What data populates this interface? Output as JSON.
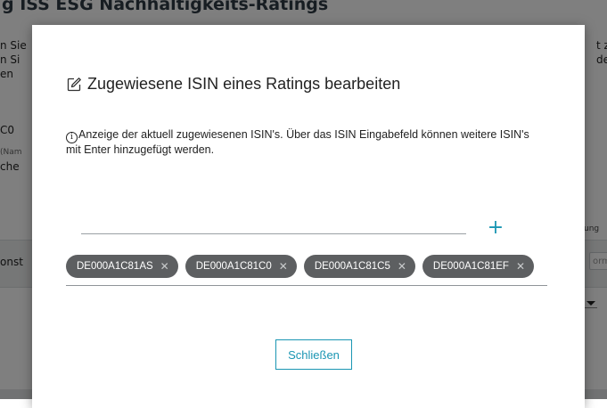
{
  "background": {
    "title": "g ISS ESG Nachhaltigkeits-Ratings",
    "left_fragments": [
      "n Sie",
      "n Si",
      "en",
      "C0",
      "(Nam",
      "che",
      "onst"
    ],
    "right_fragments": [
      "t zu",
      "der"
    ],
    "right_label": "ung",
    "right_field": "orm"
  },
  "modal": {
    "title": "Zugewiesene ISIN eines Ratings bearbeiten",
    "edit_icon": "pencil-square-icon",
    "info_icon_glyph": "i",
    "info_text": "Anzeige der aktuell zugewiesenen ISIN's. Über das ISIN Eingabefeld können weitere ISIN's mit Enter hinzugefügt werden.",
    "isin_input": {
      "value": "",
      "placeholder": ""
    },
    "add_label": "+",
    "chips": [
      {
        "label": "DE000A1C81AS",
        "remove": "✕"
      },
      {
        "label": "DE000A1C81C0",
        "remove": "✕"
      },
      {
        "label": "DE000A1C81C5",
        "remove": "✕"
      },
      {
        "label": "DE000A1C81EF",
        "remove": "✕"
      }
    ],
    "close_label": "Schließen"
  },
  "colors": {
    "accent": "#1a96b3",
    "chip_bg": "#5d5f61",
    "overlay": "rgba(0,0,0,0.5)"
  }
}
